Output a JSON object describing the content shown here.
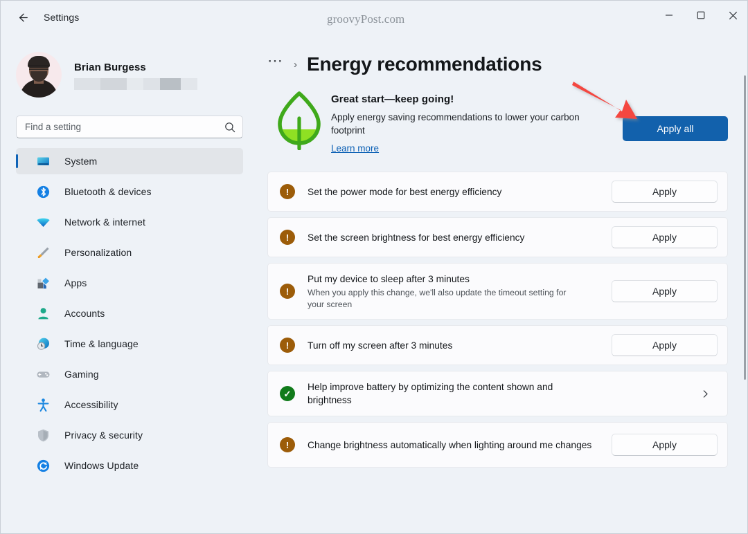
{
  "window": {
    "title": "Settings",
    "back_icon": "back-arrow-icon",
    "watermark": "groovyPost.com",
    "minimize_label": "Minimize",
    "maximize_label": "Maximize",
    "close_label": "Close"
  },
  "sidebar": {
    "profile": {
      "name": "Brian Burgess",
      "avatar_alt": "user-avatar",
      "redacted_bars": [
        {
          "width": 38,
          "color": "#dde1e6"
        },
        {
          "width": 38,
          "color": "#d2d6db"
        },
        {
          "width": 24,
          "color": "#e6eaee"
        },
        {
          "width": 24,
          "color": "#dee2e7"
        },
        {
          "width": 30,
          "color": "#b9bfc5"
        },
        {
          "width": 24,
          "color": "#e2e6eb"
        }
      ]
    },
    "search": {
      "placeholder": "Find a setting",
      "value": "",
      "icon": "search-icon"
    },
    "items": [
      {
        "label": "System",
        "icon": "monitor-icon",
        "selected": true
      },
      {
        "label": "Bluetooth & devices",
        "icon": "bluetooth-icon",
        "selected": false
      },
      {
        "label": "Network & internet",
        "icon": "wifi-icon",
        "selected": false
      },
      {
        "label": "Personalization",
        "icon": "paintbrush-icon",
        "selected": false
      },
      {
        "label": "Apps",
        "icon": "apps-icon",
        "selected": false
      },
      {
        "label": "Accounts",
        "icon": "person-icon",
        "selected": false
      },
      {
        "label": "Time & language",
        "icon": "clock-globe-icon",
        "selected": false
      },
      {
        "label": "Gaming",
        "icon": "gamepad-icon",
        "selected": false
      },
      {
        "label": "Accessibility",
        "icon": "accessibility-icon",
        "selected": false
      },
      {
        "label": "Privacy & security",
        "icon": "shield-icon",
        "selected": false
      },
      {
        "label": "Windows Update",
        "icon": "refresh-icon",
        "selected": false
      }
    ]
  },
  "main": {
    "breadcrumb": {
      "overflow": "…",
      "separator": "›",
      "title": "Energy recommendations"
    },
    "hero": {
      "icon": "leaf-icon",
      "title": "Great start—keep going!",
      "subtitle": "Apply energy saving recommendations to lower your carbon footprint",
      "link": "Learn more",
      "apply_all_label": "Apply all",
      "apply_all_color": "#1261ac"
    },
    "annotation": {
      "type": "arrow",
      "color": "#f4463f"
    },
    "recommendations": [
      {
        "status": "warning",
        "title": "Set the power mode for best energy efficiency",
        "description": "",
        "action": "Apply",
        "action_type": "button"
      },
      {
        "status": "warning",
        "title": "Set the screen brightness for best energy efficiency",
        "description": "",
        "action": "Apply",
        "action_type": "button"
      },
      {
        "status": "warning",
        "title": "Put my device to sleep after 3 minutes",
        "description": "When you apply this change, we'll also update the timeout setting for your screen",
        "action": "Apply",
        "action_type": "button"
      },
      {
        "status": "warning",
        "title": "Turn off my screen after 3 minutes",
        "description": "",
        "action": "Apply",
        "action_type": "button"
      },
      {
        "status": "done",
        "title": "Help improve battery by optimizing the content shown and brightness",
        "description": "",
        "action": "",
        "action_type": "chevron"
      },
      {
        "status": "warning",
        "title": "Change brightness automatically when lighting around me changes",
        "description": "",
        "action": "Apply",
        "action_type": "button"
      }
    ],
    "status_colors": {
      "warning": "#9c5c09",
      "done": "#117b1b"
    },
    "status_glyphs": {
      "warning": "!",
      "done": "✓"
    }
  }
}
